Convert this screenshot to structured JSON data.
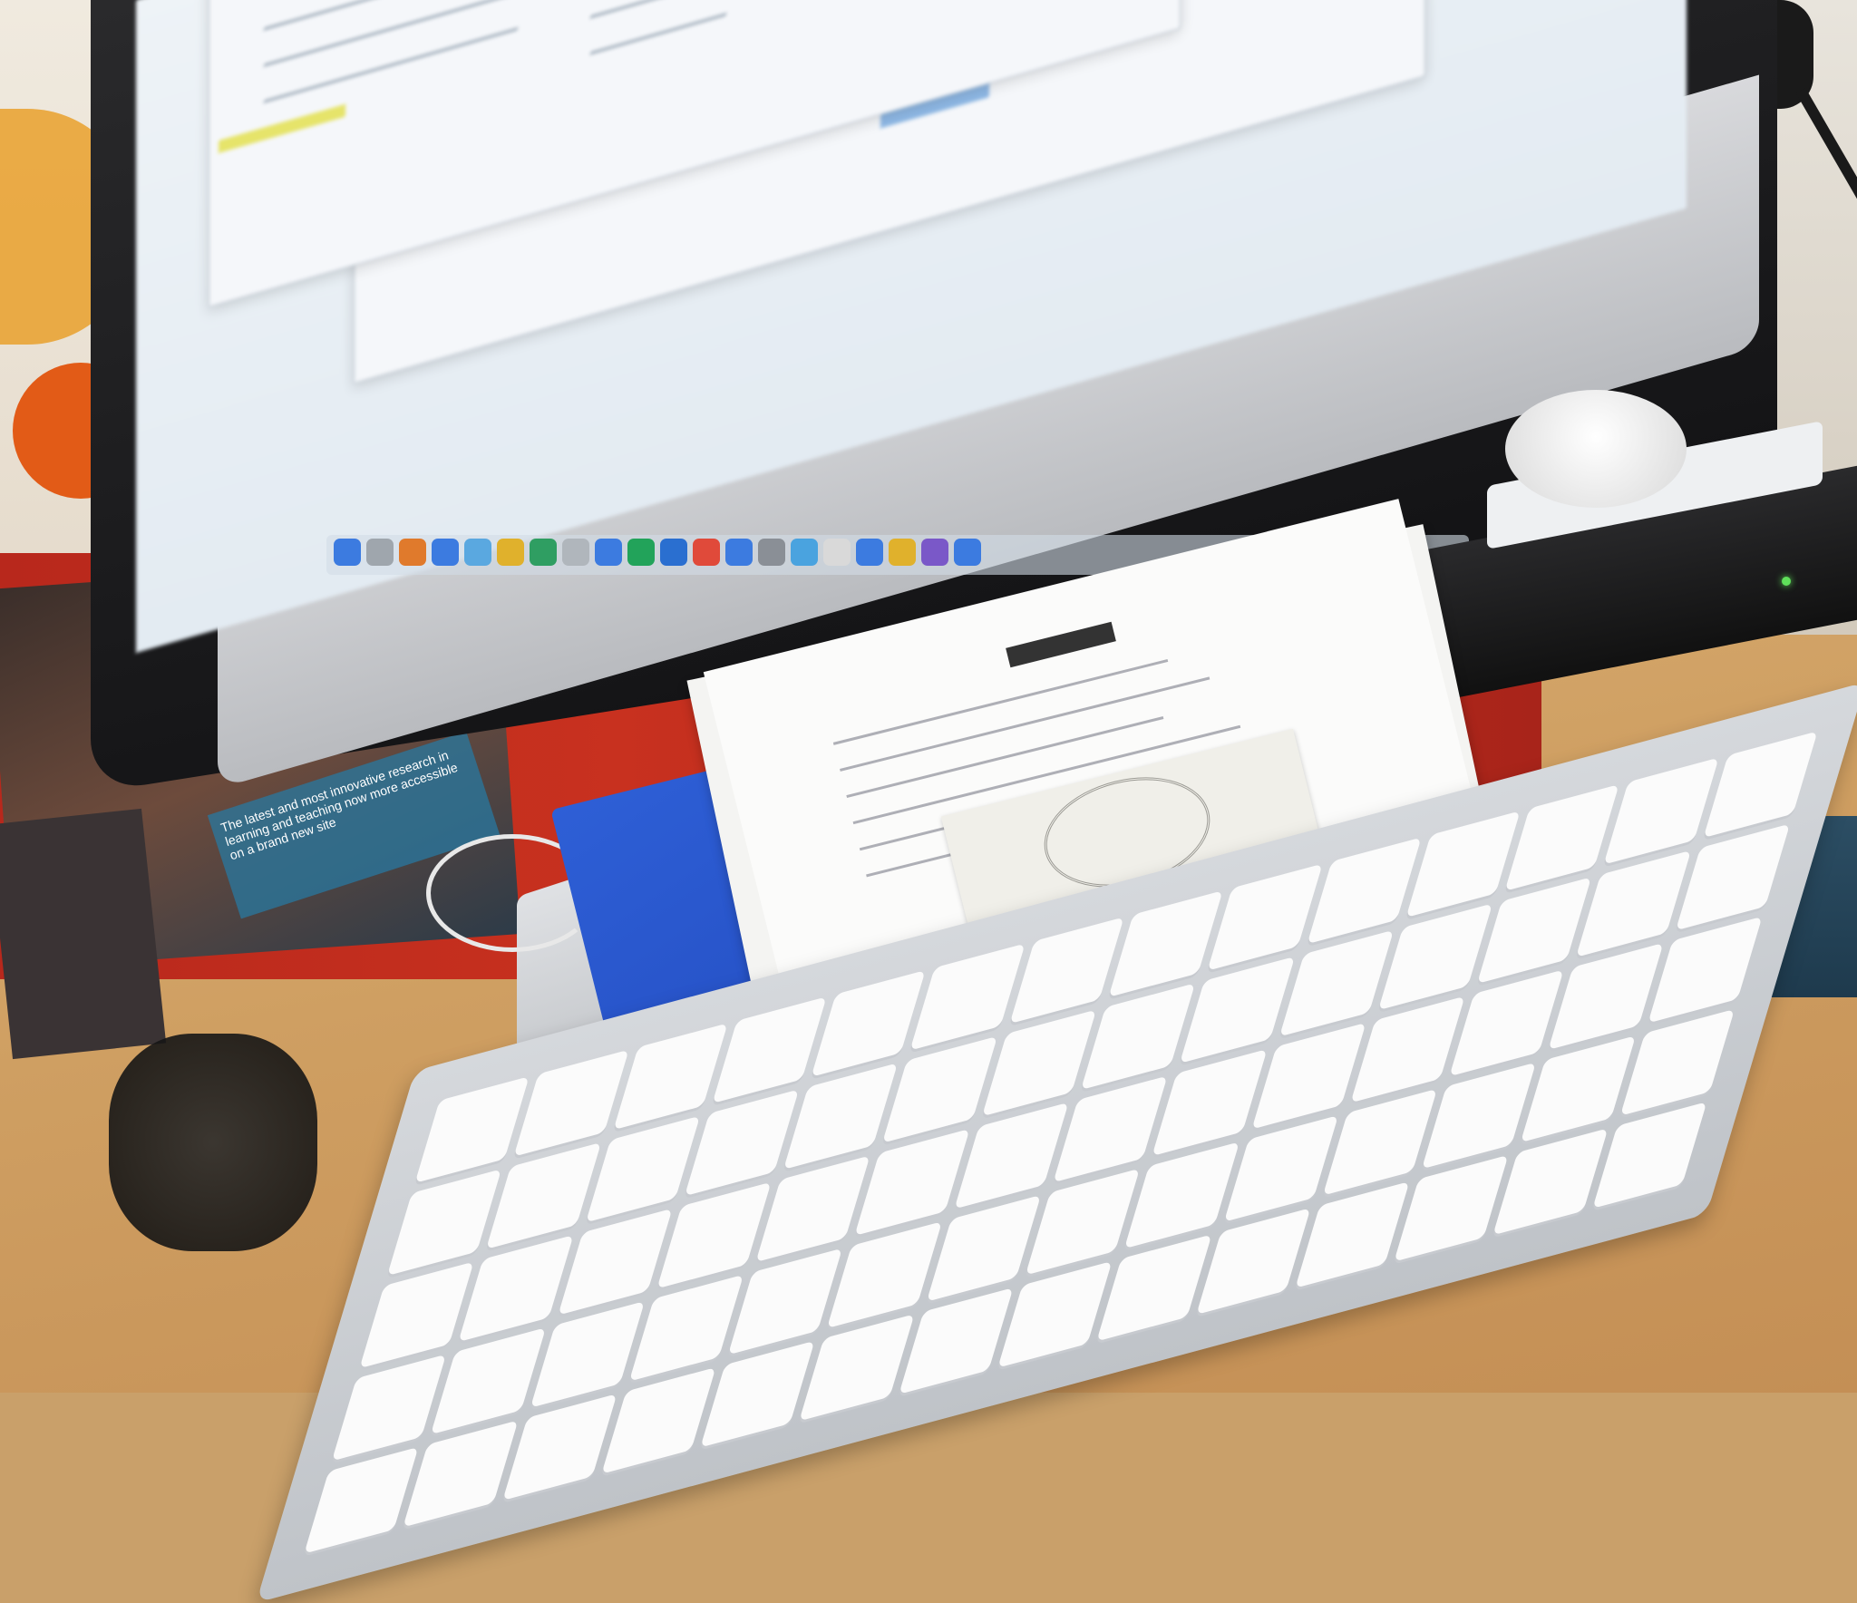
{
  "scene": {
    "description_colors": {
      "wall": "#e8e4dc",
      "desk": "#cf9f62",
      "red_panel": "#c8311f",
      "folder_blue": "#2e5fd6",
      "keyboard_key": "#fbfbfb"
    },
    "icons": [
      "apple-logo-icon"
    ],
    "apple_logo_glyph": "",
    "poster_text": "The latest and most innovative research in learning and teaching now more accessible on a brand new site"
  }
}
